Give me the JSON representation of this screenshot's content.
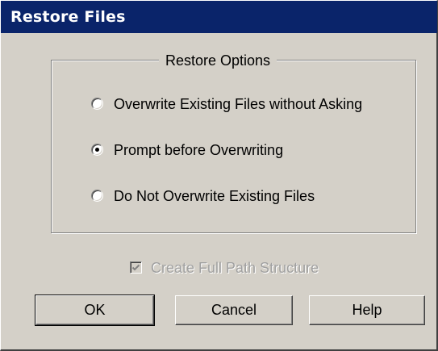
{
  "window": {
    "title": "Restore Files"
  },
  "restore_options": {
    "group_title": "Restore Options",
    "options": [
      {
        "label": "Overwrite Existing Files without Asking",
        "selected": false
      },
      {
        "label": "Prompt before Overwriting",
        "selected": true
      },
      {
        "label": "Do Not Overwrite Existing Files",
        "selected": false
      }
    ]
  },
  "full_path": {
    "label": "Create Full Path Structure",
    "checked": true,
    "enabled": false
  },
  "buttons": {
    "ok": "OK",
    "cancel": "Cancel",
    "help": "Help"
  },
  "colors": {
    "titlebar": "#0a246a",
    "face": "#d4d0c8",
    "disabled_text": "#a0a0a0"
  }
}
